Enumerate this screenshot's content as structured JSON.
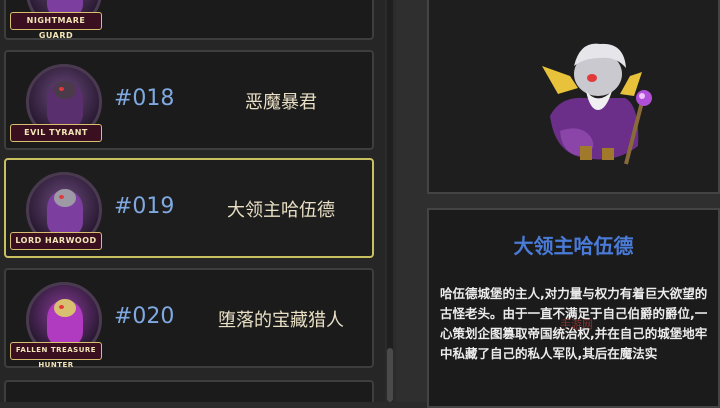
{
  "list": {
    "cards": [
      {
        "id": "top",
        "number": "",
        "name": "",
        "emblem": "NIGHTMARE GUARD"
      },
      {
        "id": "018",
        "number": "#018",
        "name": "恶魔暴君",
        "emblem": "EVIL TYRANT"
      },
      {
        "id": "019",
        "number": "#019",
        "name": "大领主哈伍德",
        "emblem": "LORD HARWOOD",
        "selected": true
      },
      {
        "id": "020",
        "number": "#020",
        "name": "堕落的宝藏猎人",
        "emblem": "FALLEN TREASURE HUNTER"
      }
    ]
  },
  "detail": {
    "title": "大领主哈伍德",
    "description": "哈伍德城堡的主人,对力量与权力有着巨大欲望的古怪老头。由于一直不满足于自己伯爵的爵位,一心策划企图篡取帝国统治权,并在自己的城堡地牢中私藏了自己的私人军队,其后在魔法实"
  },
  "watermark": "手游网",
  "colors": {
    "number": "#7fa9e0",
    "title": "#4a7bd8",
    "selected_border": "#c9c060"
  }
}
